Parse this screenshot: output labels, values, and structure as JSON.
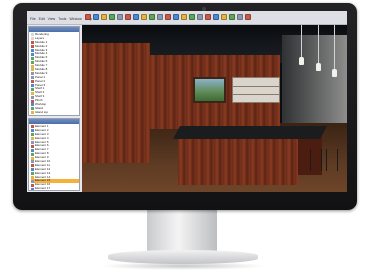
{
  "window": {
    "title": "",
    "menu": [
      "File",
      "Edit",
      "View",
      "Tools",
      "Window",
      "Help"
    ]
  },
  "toolbar": {
    "icons": [
      "new-icon",
      "open-icon",
      "save-icon",
      "print-icon",
      "undo-icon",
      "redo-icon",
      "cut-icon",
      "copy-icon",
      "paste-icon",
      "select-icon",
      "wall-icon",
      "door-icon",
      "window-icon",
      "cabinet-icon",
      "render-icon",
      "camera-icon",
      "zoom-icon",
      "pan-icon",
      "rotate-icon",
      "settings-icon",
      "help-icon"
    ]
  },
  "scene_panel": {
    "title": "",
    "items": [
      {
        "label": "Rendering",
        "color": "#d8d8d8"
      },
      {
        "label": "Layers",
        "color": "#d8d8d8"
      },
      {
        "label": "Module 1",
        "color": "#c8554a"
      },
      {
        "label": "Module 2",
        "color": "#c8554a"
      },
      {
        "label": "Module 3",
        "color": "#4f8ad0"
      },
      {
        "label": "Module 4",
        "color": "#4f8ad0"
      },
      {
        "label": "Module 5",
        "color": "#62a55b"
      },
      {
        "label": "Module 6",
        "color": "#62a55b"
      },
      {
        "label": "Module 7",
        "color": "#e1b54a"
      },
      {
        "label": "Module 8",
        "color": "#e1b54a"
      },
      {
        "label": "Module 9",
        "color": "#8c97b0"
      },
      {
        "label": "Panel 1",
        "color": "#8c97b0"
      },
      {
        "label": "Panel 2",
        "color": "#c8554a"
      },
      {
        "label": "Panel 3",
        "color": "#4f8ad0"
      },
      {
        "label": "Shelf 1",
        "color": "#62a55b"
      },
      {
        "label": "Shelf 2",
        "color": "#e1b54a"
      },
      {
        "label": "Shelf 3",
        "color": "#8c97b0"
      },
      {
        "label": "Plinth",
        "color": "#c8554a"
      },
      {
        "label": "Worktop",
        "color": "#4f8ad0"
      },
      {
        "label": "Island",
        "color": "#62a55b"
      },
      {
        "label": "Island top",
        "color": "#e1b54a"
      },
      {
        "label": "Lights",
        "color": "#8c97b0"
      }
    ]
  },
  "object_panel": {
    "title": "",
    "items": [
      {
        "label": "Element 1",
        "color": "#c8554a",
        "selected": false
      },
      {
        "label": "Element 2",
        "color": "#4f8ad0",
        "selected": false
      },
      {
        "label": "Element 3",
        "color": "#62a55b",
        "selected": false
      },
      {
        "label": "Element 4",
        "color": "#e1b54a",
        "selected": false
      },
      {
        "label": "Element 5",
        "color": "#8c97b0",
        "selected": false
      },
      {
        "label": "Element 6",
        "color": "#c8554a",
        "selected": false
      },
      {
        "label": "Element 7",
        "color": "#4f8ad0",
        "selected": false
      },
      {
        "label": "Element 8",
        "color": "#62a55b",
        "selected": false
      },
      {
        "label": "Element 9",
        "color": "#e1b54a",
        "selected": false
      },
      {
        "label": "Element 10",
        "color": "#8c97b0",
        "selected": false
      },
      {
        "label": "Element 11",
        "color": "#c8554a",
        "selected": false
      },
      {
        "label": "Element 12",
        "color": "#4f8ad0",
        "selected": false
      },
      {
        "label": "Element 13",
        "color": "#62a55b",
        "selected": false
      },
      {
        "label": "Element 14",
        "color": "#e1b54a",
        "selected": false
      },
      {
        "label": "Element 15",
        "color": "#8c97b0",
        "selected": true
      },
      {
        "label": "Element 16",
        "color": "#c8554a",
        "selected": false
      },
      {
        "label": "Element 17",
        "color": "#4f8ad0",
        "selected": false
      }
    ]
  },
  "colors": {
    "selection": "#f4b23a",
    "panel_header": "#5a7db6",
    "bezel": "#1a1a1c"
  }
}
